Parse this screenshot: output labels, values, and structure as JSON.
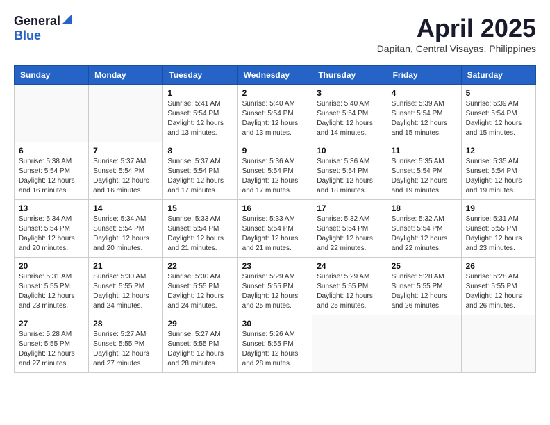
{
  "logo": {
    "general": "General",
    "blue": "Blue"
  },
  "title": {
    "month": "April 2025",
    "location": "Dapitan, Central Visayas, Philippines"
  },
  "weekdays": [
    "Sunday",
    "Monday",
    "Tuesday",
    "Wednesday",
    "Thursday",
    "Friday",
    "Saturday"
  ],
  "weeks": [
    [
      {
        "day": "",
        "info": ""
      },
      {
        "day": "",
        "info": ""
      },
      {
        "day": "1",
        "info": "Sunrise: 5:41 AM\nSunset: 5:54 PM\nDaylight: 12 hours\nand 13 minutes."
      },
      {
        "day": "2",
        "info": "Sunrise: 5:40 AM\nSunset: 5:54 PM\nDaylight: 12 hours\nand 13 minutes."
      },
      {
        "day": "3",
        "info": "Sunrise: 5:40 AM\nSunset: 5:54 PM\nDaylight: 12 hours\nand 14 minutes."
      },
      {
        "day": "4",
        "info": "Sunrise: 5:39 AM\nSunset: 5:54 PM\nDaylight: 12 hours\nand 15 minutes."
      },
      {
        "day": "5",
        "info": "Sunrise: 5:39 AM\nSunset: 5:54 PM\nDaylight: 12 hours\nand 15 minutes."
      }
    ],
    [
      {
        "day": "6",
        "info": "Sunrise: 5:38 AM\nSunset: 5:54 PM\nDaylight: 12 hours\nand 16 minutes."
      },
      {
        "day": "7",
        "info": "Sunrise: 5:37 AM\nSunset: 5:54 PM\nDaylight: 12 hours\nand 16 minutes."
      },
      {
        "day": "8",
        "info": "Sunrise: 5:37 AM\nSunset: 5:54 PM\nDaylight: 12 hours\nand 17 minutes."
      },
      {
        "day": "9",
        "info": "Sunrise: 5:36 AM\nSunset: 5:54 PM\nDaylight: 12 hours\nand 17 minutes."
      },
      {
        "day": "10",
        "info": "Sunrise: 5:36 AM\nSunset: 5:54 PM\nDaylight: 12 hours\nand 18 minutes."
      },
      {
        "day": "11",
        "info": "Sunrise: 5:35 AM\nSunset: 5:54 PM\nDaylight: 12 hours\nand 19 minutes."
      },
      {
        "day": "12",
        "info": "Sunrise: 5:35 AM\nSunset: 5:54 PM\nDaylight: 12 hours\nand 19 minutes."
      }
    ],
    [
      {
        "day": "13",
        "info": "Sunrise: 5:34 AM\nSunset: 5:54 PM\nDaylight: 12 hours\nand 20 minutes."
      },
      {
        "day": "14",
        "info": "Sunrise: 5:34 AM\nSunset: 5:54 PM\nDaylight: 12 hours\nand 20 minutes."
      },
      {
        "day": "15",
        "info": "Sunrise: 5:33 AM\nSunset: 5:54 PM\nDaylight: 12 hours\nand 21 minutes."
      },
      {
        "day": "16",
        "info": "Sunrise: 5:33 AM\nSunset: 5:54 PM\nDaylight: 12 hours\nand 21 minutes."
      },
      {
        "day": "17",
        "info": "Sunrise: 5:32 AM\nSunset: 5:54 PM\nDaylight: 12 hours\nand 22 minutes."
      },
      {
        "day": "18",
        "info": "Sunrise: 5:32 AM\nSunset: 5:54 PM\nDaylight: 12 hours\nand 22 minutes."
      },
      {
        "day": "19",
        "info": "Sunrise: 5:31 AM\nSunset: 5:55 PM\nDaylight: 12 hours\nand 23 minutes."
      }
    ],
    [
      {
        "day": "20",
        "info": "Sunrise: 5:31 AM\nSunset: 5:55 PM\nDaylight: 12 hours\nand 23 minutes."
      },
      {
        "day": "21",
        "info": "Sunrise: 5:30 AM\nSunset: 5:55 PM\nDaylight: 12 hours\nand 24 minutes."
      },
      {
        "day": "22",
        "info": "Sunrise: 5:30 AM\nSunset: 5:55 PM\nDaylight: 12 hours\nand 24 minutes."
      },
      {
        "day": "23",
        "info": "Sunrise: 5:29 AM\nSunset: 5:55 PM\nDaylight: 12 hours\nand 25 minutes."
      },
      {
        "day": "24",
        "info": "Sunrise: 5:29 AM\nSunset: 5:55 PM\nDaylight: 12 hours\nand 25 minutes."
      },
      {
        "day": "25",
        "info": "Sunrise: 5:28 AM\nSunset: 5:55 PM\nDaylight: 12 hours\nand 26 minutes."
      },
      {
        "day": "26",
        "info": "Sunrise: 5:28 AM\nSunset: 5:55 PM\nDaylight: 12 hours\nand 26 minutes."
      }
    ],
    [
      {
        "day": "27",
        "info": "Sunrise: 5:28 AM\nSunset: 5:55 PM\nDaylight: 12 hours\nand 27 minutes."
      },
      {
        "day": "28",
        "info": "Sunrise: 5:27 AM\nSunset: 5:55 PM\nDaylight: 12 hours\nand 27 minutes."
      },
      {
        "day": "29",
        "info": "Sunrise: 5:27 AM\nSunset: 5:55 PM\nDaylight: 12 hours\nand 28 minutes."
      },
      {
        "day": "30",
        "info": "Sunrise: 5:26 AM\nSunset: 5:55 PM\nDaylight: 12 hours\nand 28 minutes."
      },
      {
        "day": "",
        "info": ""
      },
      {
        "day": "",
        "info": ""
      },
      {
        "day": "",
        "info": ""
      }
    ]
  ]
}
